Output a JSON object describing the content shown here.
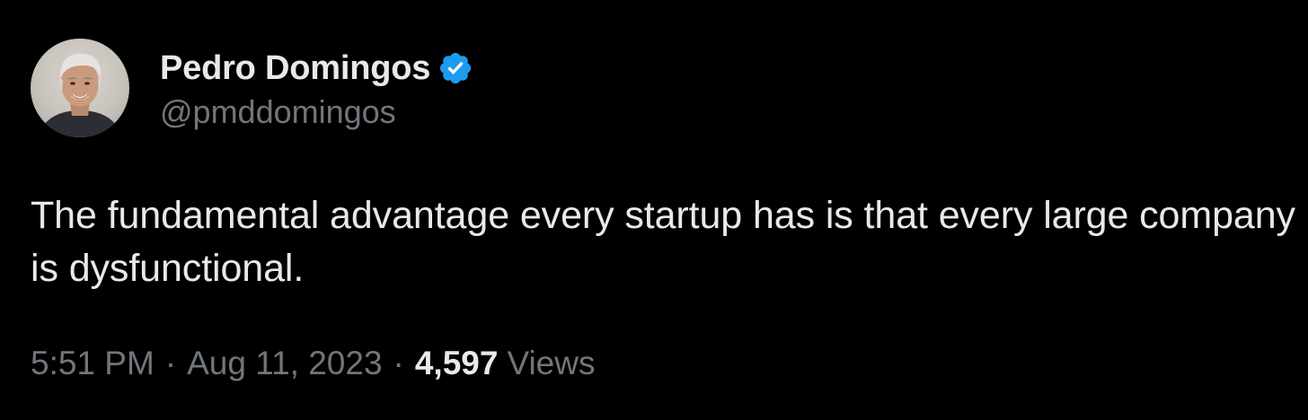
{
  "tweet": {
    "author": {
      "display_name": "Pedro Domingos",
      "handle": "@pmddomingos",
      "verified": true,
      "verified_color": "#1d9bf0"
    },
    "text": "The fundamental advantage every startup has is that every large company is dysfunctional.",
    "meta": {
      "time": "5:51 PM",
      "separator": "·",
      "date": "Aug 11, 2023",
      "views_count": "4,597",
      "views_label": "Views"
    }
  },
  "colors": {
    "background": "#000000",
    "primary_text": "#e7e9ea",
    "secondary_text": "#71767b"
  }
}
